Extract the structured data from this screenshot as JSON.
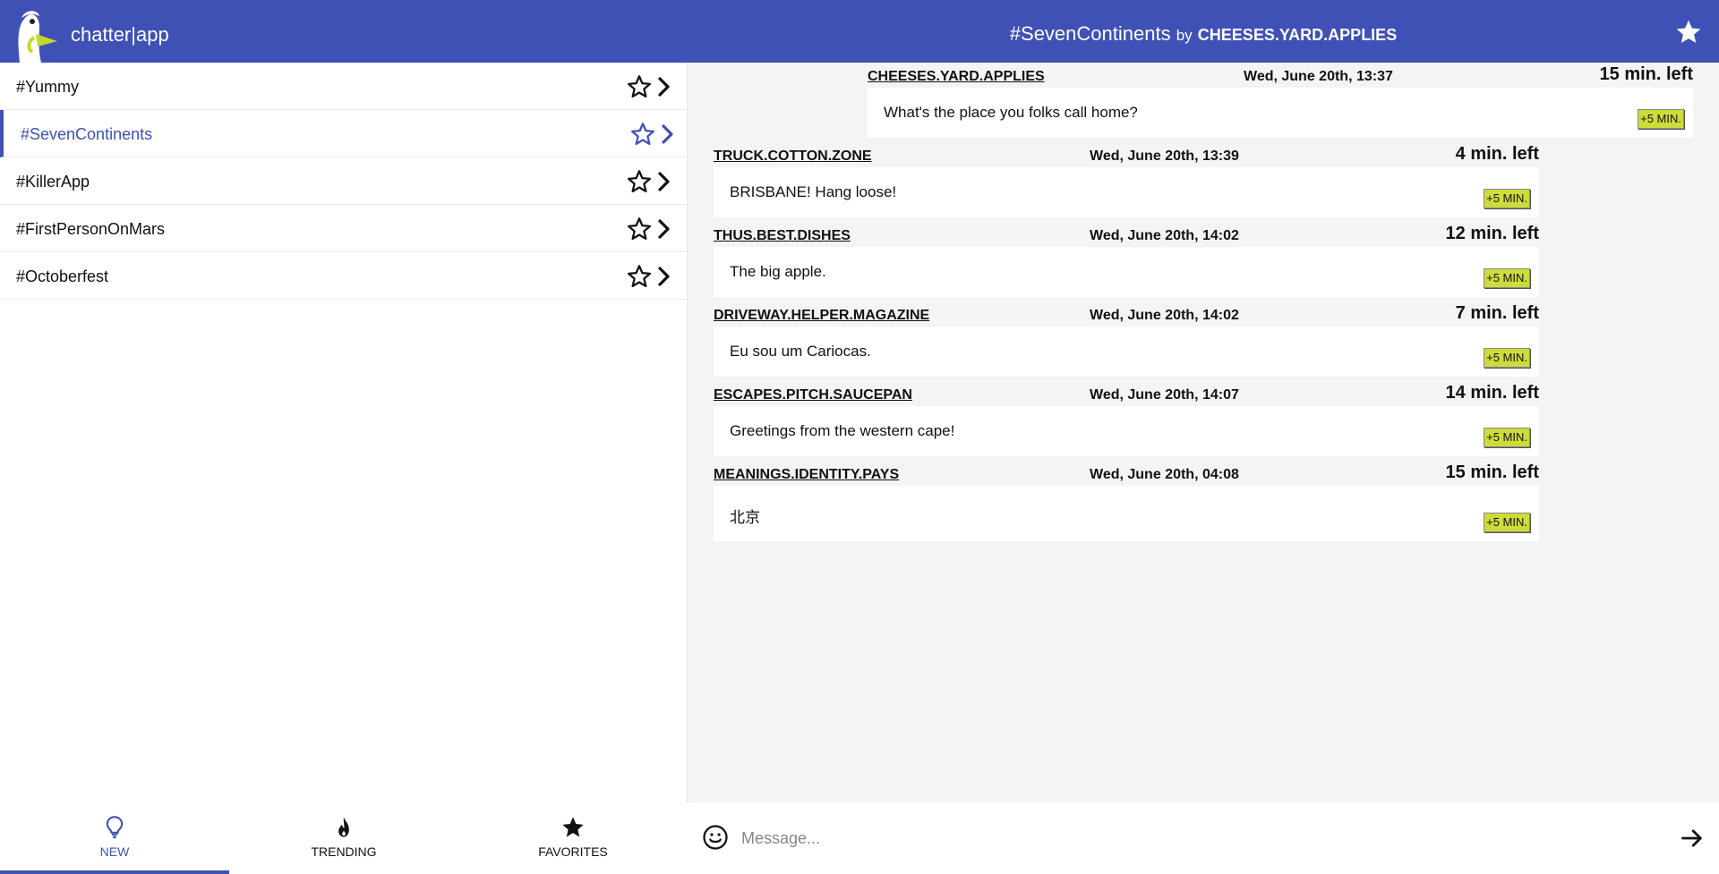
{
  "header": {
    "app_title": "chatter|app",
    "channel_name": "#SevenContinents",
    "by_label": "by",
    "channel_owner": "CHEESES.YARD.APPLIES"
  },
  "sidebar": {
    "channels": [
      {
        "label": "#Yummy",
        "active": false
      },
      {
        "label": "#SevenContinents",
        "active": true
      },
      {
        "label": "#KillerApp",
        "active": false
      },
      {
        "label": "#FirstPersonOnMars",
        "active": false
      },
      {
        "label": "#Octoberfest",
        "active": false
      }
    ],
    "tabs": [
      {
        "label": "NEW",
        "icon": "lightbulb-icon",
        "active": true
      },
      {
        "label": "TRENDING",
        "icon": "flame-icon",
        "active": false
      },
      {
        "label": "FAVORITES",
        "icon": "star-icon",
        "active": false
      }
    ]
  },
  "messages": [
    {
      "user": "CHEESES.YARD.APPLIES",
      "date": "Wed, June 20th, 13:37",
      "time_left": "15 min. left",
      "text": "What's the place you folks call home?",
      "button": "+5 MIN.",
      "own": true
    },
    {
      "user": "TRUCK.COTTON.ZONE",
      "date": "Wed, June 20th, 13:39",
      "time_left": "4 min. left",
      "text": "BRISBANE! Hang loose!",
      "button": "+5 MIN.",
      "own": false
    },
    {
      "user": "THUS.BEST.DISHES",
      "date": "Wed, June 20th, 14:02",
      "time_left": "12 min. left",
      "text": "The big apple.",
      "button": "+5 MIN.",
      "own": false
    },
    {
      "user": "DRIVEWAY.HELPER.MAGAZINE",
      "date": "Wed, June 20th, 14:02",
      "time_left": "7 min. left",
      "text": "Eu sou um Cariocas.",
      "button": "+5 MIN.",
      "own": false
    },
    {
      "user": "ESCAPES.PITCH.SAUCEPAN",
      "date": "Wed, June 20th, 14:07",
      "time_left": "14 min. left",
      "text": "Greetings from the western cape!",
      "button": "+5 MIN.",
      "own": false
    },
    {
      "user": "MEANINGS.IDENTITY.PAYS",
      "date": "Wed, June 20th, 04:08",
      "time_left": "15 min. left",
      "text": "北京",
      "button": "+5 MIN.",
      "own": false
    }
  ],
  "composer": {
    "placeholder": "Message..."
  },
  "colors": {
    "primary": "#3f51b5",
    "plus_button": "#cddc39",
    "chat_background": "#f4f4f4"
  }
}
